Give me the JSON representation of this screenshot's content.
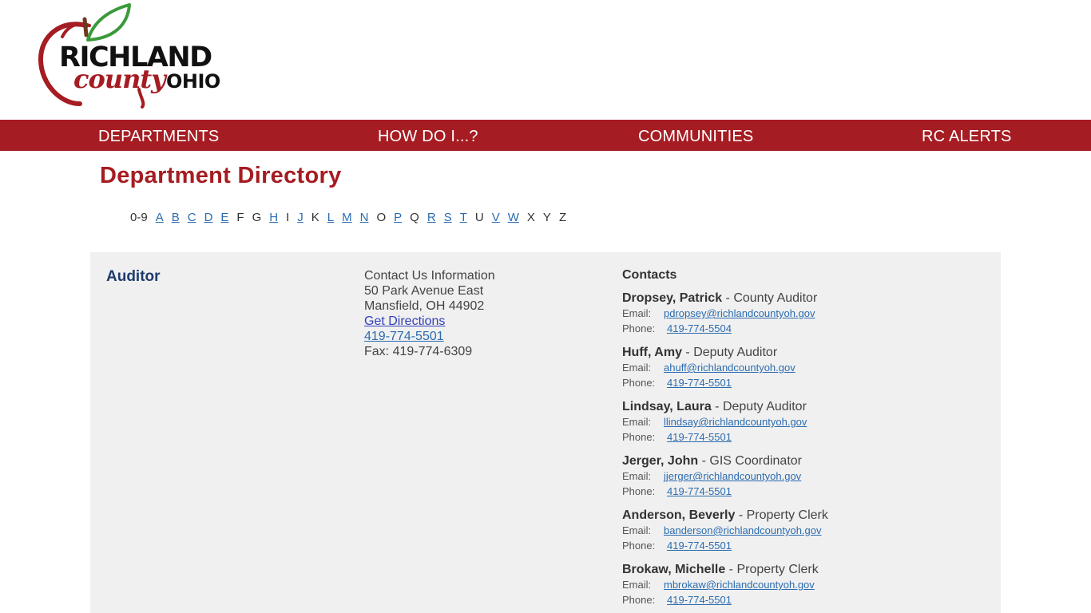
{
  "colors": {
    "brand_red": "#a51c22",
    "link_blue": "#2b6cb0",
    "department_navy": "#1f3c6e",
    "card_gray": "#f0f0f0"
  },
  "logo": {
    "word_top": "RICHLAND",
    "word_script": "county",
    "word_state": "OHIO"
  },
  "nav": {
    "items": [
      "DEPARTMENTS",
      "HOW DO I...?",
      "COMMUNITIES",
      "RC ALERTS"
    ]
  },
  "page": {
    "title": "Department Directory"
  },
  "alphabet": [
    {
      "label": "0-9",
      "link": false
    },
    {
      "label": "A",
      "link": true
    },
    {
      "label": "B",
      "link": true
    },
    {
      "label": "C",
      "link": true
    },
    {
      "label": "D",
      "link": true
    },
    {
      "label": "E",
      "link": true
    },
    {
      "label": "F",
      "link": false
    },
    {
      "label": "G",
      "link": false
    },
    {
      "label": "H",
      "link": true
    },
    {
      "label": "I",
      "link": false
    },
    {
      "label": "J",
      "link": true
    },
    {
      "label": "K",
      "link": false
    },
    {
      "label": "L",
      "link": true
    },
    {
      "label": "M",
      "link": true
    },
    {
      "label": "N",
      "link": true
    },
    {
      "label": "O",
      "link": false
    },
    {
      "label": "P",
      "link": true
    },
    {
      "label": "Q",
      "link": false
    },
    {
      "label": "R",
      "link": true
    },
    {
      "label": "S",
      "link": true
    },
    {
      "label": "T",
      "link": true
    },
    {
      "label": "U",
      "link": false
    },
    {
      "label": "V",
      "link": true
    },
    {
      "label": "W",
      "link": true
    },
    {
      "label": "X",
      "link": false
    },
    {
      "label": "Y",
      "link": false
    },
    {
      "label": "Z",
      "link": false
    }
  ],
  "department": {
    "name": "Auditor",
    "contact_info": {
      "heading": "Contact Us Information",
      "address_line1": "50 Park Avenue East",
      "address_line2": "Mansfield, OH 44902",
      "directions_label": "Get Directions",
      "phone": "419-774-5501",
      "fax": "Fax: 419-774-6309"
    },
    "contacts_heading": "Contacts",
    "email_label": "Email:",
    "phone_label": "Phone:",
    "contacts": [
      {
        "name": "Dropsey, Patrick",
        "title": " - County Auditor",
        "email": "pdropsey@richlandcountyoh.gov",
        "phone": "419-774-5504"
      },
      {
        "name": "Huff, Amy",
        "title": " - Deputy Auditor",
        "email": "ahuff@richlandcountyoh.gov",
        "phone": "419-774-5501"
      },
      {
        "name": "Lindsay, Laura",
        "title": " - Deputy Auditor",
        "email": "llindsay@richlandcountyoh.gov",
        "phone": "419-774-5501"
      },
      {
        "name": "Jerger, John",
        "title": " - GIS Coordinator",
        "email": "jjerger@richlandcountyoh.gov",
        "phone": "419-774-5501"
      },
      {
        "name": "Anderson, Beverly",
        "title": " - Property Clerk",
        "email": "banderson@richlandcountyoh.gov",
        "phone": "419-774-5501"
      },
      {
        "name": "Brokaw, Michelle",
        "title": " - Property Clerk",
        "email": "mbrokaw@richlandcountyoh.gov",
        "phone": "419-774-5501"
      }
    ]
  }
}
